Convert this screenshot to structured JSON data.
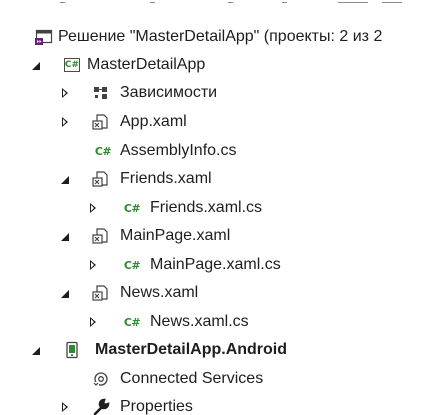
{
  "solution_explorer": {
    "solution_label": "Решение \"MasterDetailApp\" (проекты: 2 из 2",
    "items": [
      {
        "label": "MasterDetailApp",
        "icon": "csharp-project-icon",
        "state": "expanded"
      },
      {
        "label": "Зависимости",
        "icon": "dependencies-icon",
        "state": "collapsed"
      },
      {
        "label": "App.xaml",
        "icon": "xaml-file-icon",
        "state": "collapsed"
      },
      {
        "label": "AssemblyInfo.cs",
        "icon": "csharp-file-icon",
        "state": "none"
      },
      {
        "label": "Friends.xaml",
        "icon": "xaml-file-icon",
        "state": "expanded"
      },
      {
        "label": "Friends.xaml.cs",
        "icon": "csharp-file-icon",
        "state": "collapsed"
      },
      {
        "label": "MainPage.xaml",
        "icon": "xaml-file-icon",
        "state": "expanded"
      },
      {
        "label": "MainPage.xaml.cs",
        "icon": "csharp-file-icon",
        "state": "collapsed"
      },
      {
        "label": "News.xaml",
        "icon": "xaml-file-icon",
        "state": "expanded"
      },
      {
        "label": "News.xaml.cs",
        "icon": "csharp-file-icon",
        "state": "collapsed"
      },
      {
        "label": "MasterDetailApp.Android",
        "icon": "android-project-icon",
        "state": "expanded"
      },
      {
        "label": "Connected Services",
        "icon": "connected-services-icon",
        "state": "none"
      },
      {
        "label": "Properties",
        "icon": "wrench-icon",
        "state": "collapsed"
      }
    ],
    "icon_badges": {
      "csharp": "C#"
    },
    "colors": {
      "csharp_green": "#2f8a2f",
      "solution_purple": "#68217a",
      "text": "#1e1e1e"
    }
  }
}
